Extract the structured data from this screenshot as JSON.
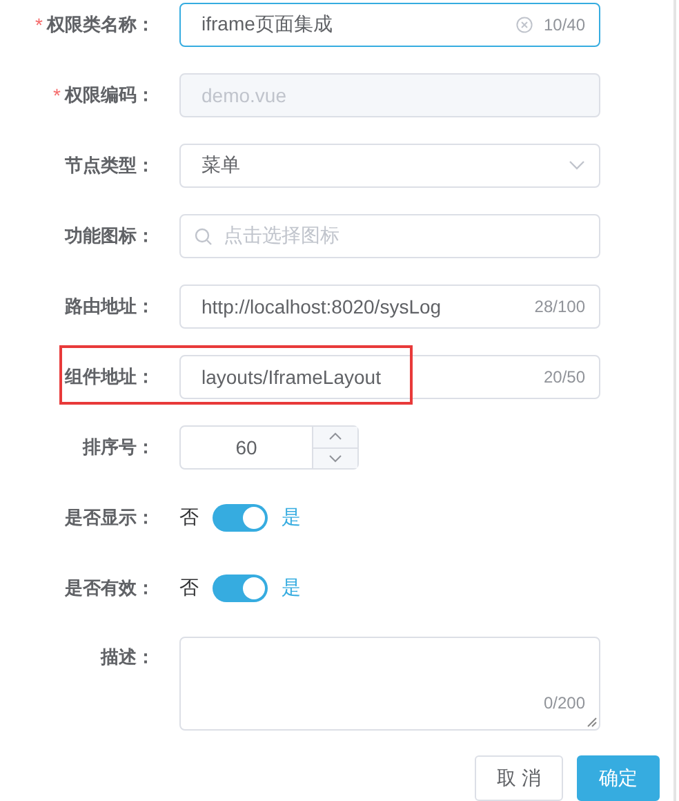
{
  "fields": [
    {
      "kind": "text",
      "label": "权限类名称：",
      "required_mark": "*",
      "value": "iframe页面集成",
      "counter": "10/40",
      "clearable": true,
      "focused": true,
      "disabled": false
    },
    {
      "kind": "text",
      "label": "权限编码：",
      "required_mark": "*",
      "value": "demo.vue",
      "clearable": false,
      "focused": false,
      "disabled": true
    },
    {
      "kind": "select",
      "label": "节点类型：",
      "value": "菜单"
    },
    {
      "kind": "icon-picker",
      "label": "功能图标：",
      "placeholder": "点击选择图标"
    },
    {
      "kind": "text",
      "label": "路由地址：",
      "value": "http://localhost:8020/sysLog",
      "counter": "28/100",
      "clearable": false,
      "focused": false,
      "disabled": false
    },
    {
      "kind": "text",
      "label": "组件地址：",
      "highlighted": true,
      "value": "layouts/IframeLayout",
      "counter": "20/50",
      "clearable": false,
      "focused": false,
      "disabled": false
    },
    {
      "kind": "number",
      "label": "排序号：",
      "value": "60"
    },
    {
      "kind": "switch",
      "label": "是否显示：",
      "off_label": "否",
      "on_label": "是",
      "on": true
    },
    {
      "kind": "switch",
      "label": "是否有效：",
      "off_label": "否",
      "on_label": "是",
      "on": true
    },
    {
      "kind": "textarea",
      "label": "描述：",
      "counter": "0/200"
    }
  ],
  "buttons": [
    {
      "label": "取 消",
      "primary": false
    },
    {
      "label": "确定",
      "primary": true
    }
  ]
}
